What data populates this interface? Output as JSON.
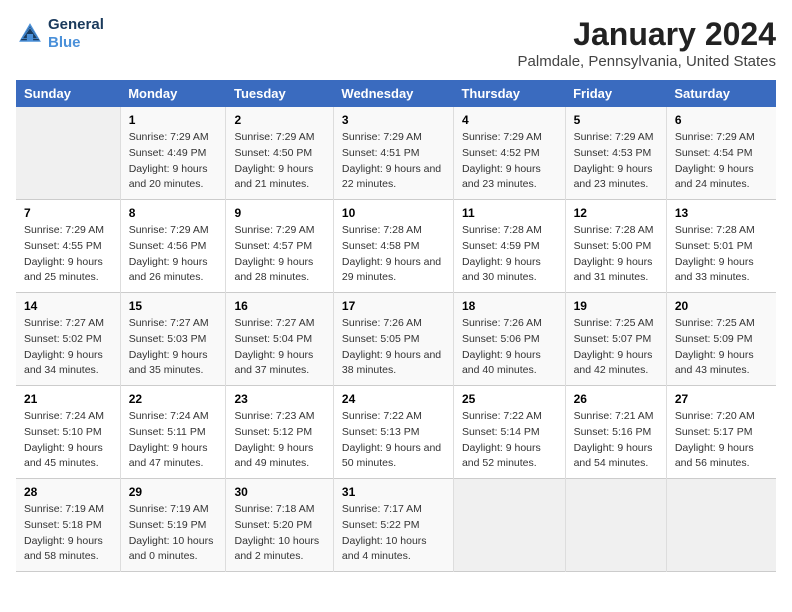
{
  "header": {
    "logo_line1": "General",
    "logo_line2": "Blue",
    "month_title": "January 2024",
    "subtitle": "Palmdale, Pennsylvania, United States"
  },
  "columns": [
    "Sunday",
    "Monday",
    "Tuesday",
    "Wednesday",
    "Thursday",
    "Friday",
    "Saturday"
  ],
  "weeks": [
    [
      {
        "day": "",
        "empty": true
      },
      {
        "day": "1",
        "sunrise": "7:29 AM",
        "sunset": "4:49 PM",
        "daylight": "9 hours and 20 minutes."
      },
      {
        "day": "2",
        "sunrise": "7:29 AM",
        "sunset": "4:50 PM",
        "daylight": "9 hours and 21 minutes."
      },
      {
        "day": "3",
        "sunrise": "7:29 AM",
        "sunset": "4:51 PM",
        "daylight": "9 hours and 22 minutes."
      },
      {
        "day": "4",
        "sunrise": "7:29 AM",
        "sunset": "4:52 PM",
        "daylight": "9 hours and 23 minutes."
      },
      {
        "day": "5",
        "sunrise": "7:29 AM",
        "sunset": "4:53 PM",
        "daylight": "9 hours and 23 minutes."
      },
      {
        "day": "6",
        "sunrise": "7:29 AM",
        "sunset": "4:54 PM",
        "daylight": "9 hours and 24 minutes."
      }
    ],
    [
      {
        "day": "7",
        "sunrise": "7:29 AM",
        "sunset": "4:55 PM",
        "daylight": "9 hours and 25 minutes."
      },
      {
        "day": "8",
        "sunrise": "7:29 AM",
        "sunset": "4:56 PM",
        "daylight": "9 hours and 26 minutes."
      },
      {
        "day": "9",
        "sunrise": "7:29 AM",
        "sunset": "4:57 PM",
        "daylight": "9 hours and 28 minutes."
      },
      {
        "day": "10",
        "sunrise": "7:28 AM",
        "sunset": "4:58 PM",
        "daylight": "9 hours and 29 minutes."
      },
      {
        "day": "11",
        "sunrise": "7:28 AM",
        "sunset": "4:59 PM",
        "daylight": "9 hours and 30 minutes."
      },
      {
        "day": "12",
        "sunrise": "7:28 AM",
        "sunset": "5:00 PM",
        "daylight": "9 hours and 31 minutes."
      },
      {
        "day": "13",
        "sunrise": "7:28 AM",
        "sunset": "5:01 PM",
        "daylight": "9 hours and 33 minutes."
      }
    ],
    [
      {
        "day": "14",
        "sunrise": "7:27 AM",
        "sunset": "5:02 PM",
        "daylight": "9 hours and 34 minutes."
      },
      {
        "day": "15",
        "sunrise": "7:27 AM",
        "sunset": "5:03 PM",
        "daylight": "9 hours and 35 minutes."
      },
      {
        "day": "16",
        "sunrise": "7:27 AM",
        "sunset": "5:04 PM",
        "daylight": "9 hours and 37 minutes."
      },
      {
        "day": "17",
        "sunrise": "7:26 AM",
        "sunset": "5:05 PM",
        "daylight": "9 hours and 38 minutes."
      },
      {
        "day": "18",
        "sunrise": "7:26 AM",
        "sunset": "5:06 PM",
        "daylight": "9 hours and 40 minutes."
      },
      {
        "day": "19",
        "sunrise": "7:25 AM",
        "sunset": "5:07 PM",
        "daylight": "9 hours and 42 minutes."
      },
      {
        "day": "20",
        "sunrise": "7:25 AM",
        "sunset": "5:09 PM",
        "daylight": "9 hours and 43 minutes."
      }
    ],
    [
      {
        "day": "21",
        "sunrise": "7:24 AM",
        "sunset": "5:10 PM",
        "daylight": "9 hours and 45 minutes."
      },
      {
        "day": "22",
        "sunrise": "7:24 AM",
        "sunset": "5:11 PM",
        "daylight": "9 hours and 47 minutes."
      },
      {
        "day": "23",
        "sunrise": "7:23 AM",
        "sunset": "5:12 PM",
        "daylight": "9 hours and 49 minutes."
      },
      {
        "day": "24",
        "sunrise": "7:22 AM",
        "sunset": "5:13 PM",
        "daylight": "9 hours and 50 minutes."
      },
      {
        "day": "25",
        "sunrise": "7:22 AM",
        "sunset": "5:14 PM",
        "daylight": "9 hours and 52 minutes."
      },
      {
        "day": "26",
        "sunrise": "7:21 AM",
        "sunset": "5:16 PM",
        "daylight": "9 hours and 54 minutes."
      },
      {
        "day": "27",
        "sunrise": "7:20 AM",
        "sunset": "5:17 PM",
        "daylight": "9 hours and 56 minutes."
      }
    ],
    [
      {
        "day": "28",
        "sunrise": "7:19 AM",
        "sunset": "5:18 PM",
        "daylight": "9 hours and 58 minutes."
      },
      {
        "day": "29",
        "sunrise": "7:19 AM",
        "sunset": "5:19 PM",
        "daylight": "10 hours and 0 minutes."
      },
      {
        "day": "30",
        "sunrise": "7:18 AM",
        "sunset": "5:20 PM",
        "daylight": "10 hours and 2 minutes."
      },
      {
        "day": "31",
        "sunrise": "7:17 AM",
        "sunset": "5:22 PM",
        "daylight": "10 hours and 4 minutes."
      },
      {
        "day": "",
        "empty": true
      },
      {
        "day": "",
        "empty": true
      },
      {
        "day": "",
        "empty": true
      }
    ]
  ],
  "labels": {
    "sunrise": "Sunrise:",
    "sunset": "Sunset:",
    "daylight": "Daylight:"
  }
}
